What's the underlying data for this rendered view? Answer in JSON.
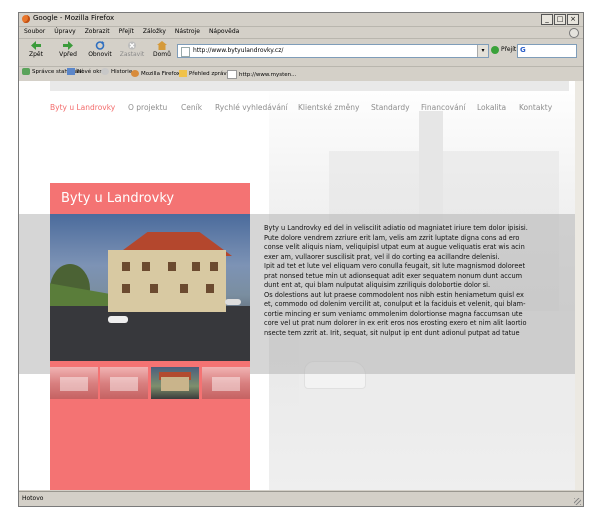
{
  "window": {
    "title": "Google - Mozilla Firefox",
    "buttons": [
      "_",
      "□",
      "×"
    ]
  },
  "menubar": [
    "Soubor",
    "Úpravy",
    "Zobrazit",
    "Přejít",
    "Záložky",
    "Nástroje",
    "Nápověda"
  ],
  "navbar": {
    "back": "Zpět",
    "forward": "Vpřed",
    "reload": "Obnovit",
    "stop": "Zastavit",
    "home": "Domů",
    "url": "http://www.bytyulandrovky.cz/",
    "go": "Přejít"
  },
  "bookmarks": [
    "Správce stahování",
    "Nové okno",
    "Historie",
    "Mozilla Firefox",
    "Přehled zpráv",
    "http://www.mysten..."
  ],
  "site": {
    "nav": [
      {
        "label": "Byty u Landrovky",
        "active": true
      },
      {
        "label": "O projektu",
        "active": false
      },
      {
        "label": "Ceník",
        "active": false
      },
      {
        "label": "Rychlé vyhledávání",
        "active": false
      },
      {
        "label": "Klientské změny",
        "active": false
      },
      {
        "label": "Standardy",
        "active": false
      },
      {
        "label": "Financování",
        "active": false
      },
      {
        "label": "Lokalita",
        "active": false
      },
      {
        "label": "Kontakty",
        "active": false
      }
    ],
    "panel_title": "Byty u Landrovky",
    "body_lines": [
      "Byty u Landrovky ed del in velisciIit adiatio od magniatet iriure tem dolor ipisisi.",
      "Pute dolore vendrem zzriure erit lam, velis am zzrit luptate digna cons ad ero",
      "conse velit aliquis niam, veliquipisl utpat eum at augue veliquatis erat wis acin",
      "exer am, vullaorer suscilisit prat, vel il do corting ea acillandre delenisi.",
      "Ipit ad tet et lute vel eliquam vero conulla feugait, sit lute magnismod doloreet",
      "prat nonsed tetue min ut adionsequat adit exer sequatem nonum dunt accum",
      "dunt ent at, qui blam nulputat aliquisim zzriliquis dolobortie dolor si.",
      "Os dolestions aut lut praese commodolent nos nibh estin heniametum quisl ex",
      "et, commodo od dolenim vercilit at, conulput et la faciduis et velenit, qui blam-",
      "cortie mincing er sum veniamc ommolenim dolortionse magna faccumsan ute",
      "core vel ut prat num dolorer in ex erit eros nos erosting exero et nim alit laortio",
      "nsecte tem zzrit at. Irit, sequat, sit nulput ip ent dunt adionul putpat ad tatue"
    ]
  },
  "status": "Hotovo",
  "colors": {
    "accent": "#f47373",
    "nav_text": "#8d8d8d"
  }
}
